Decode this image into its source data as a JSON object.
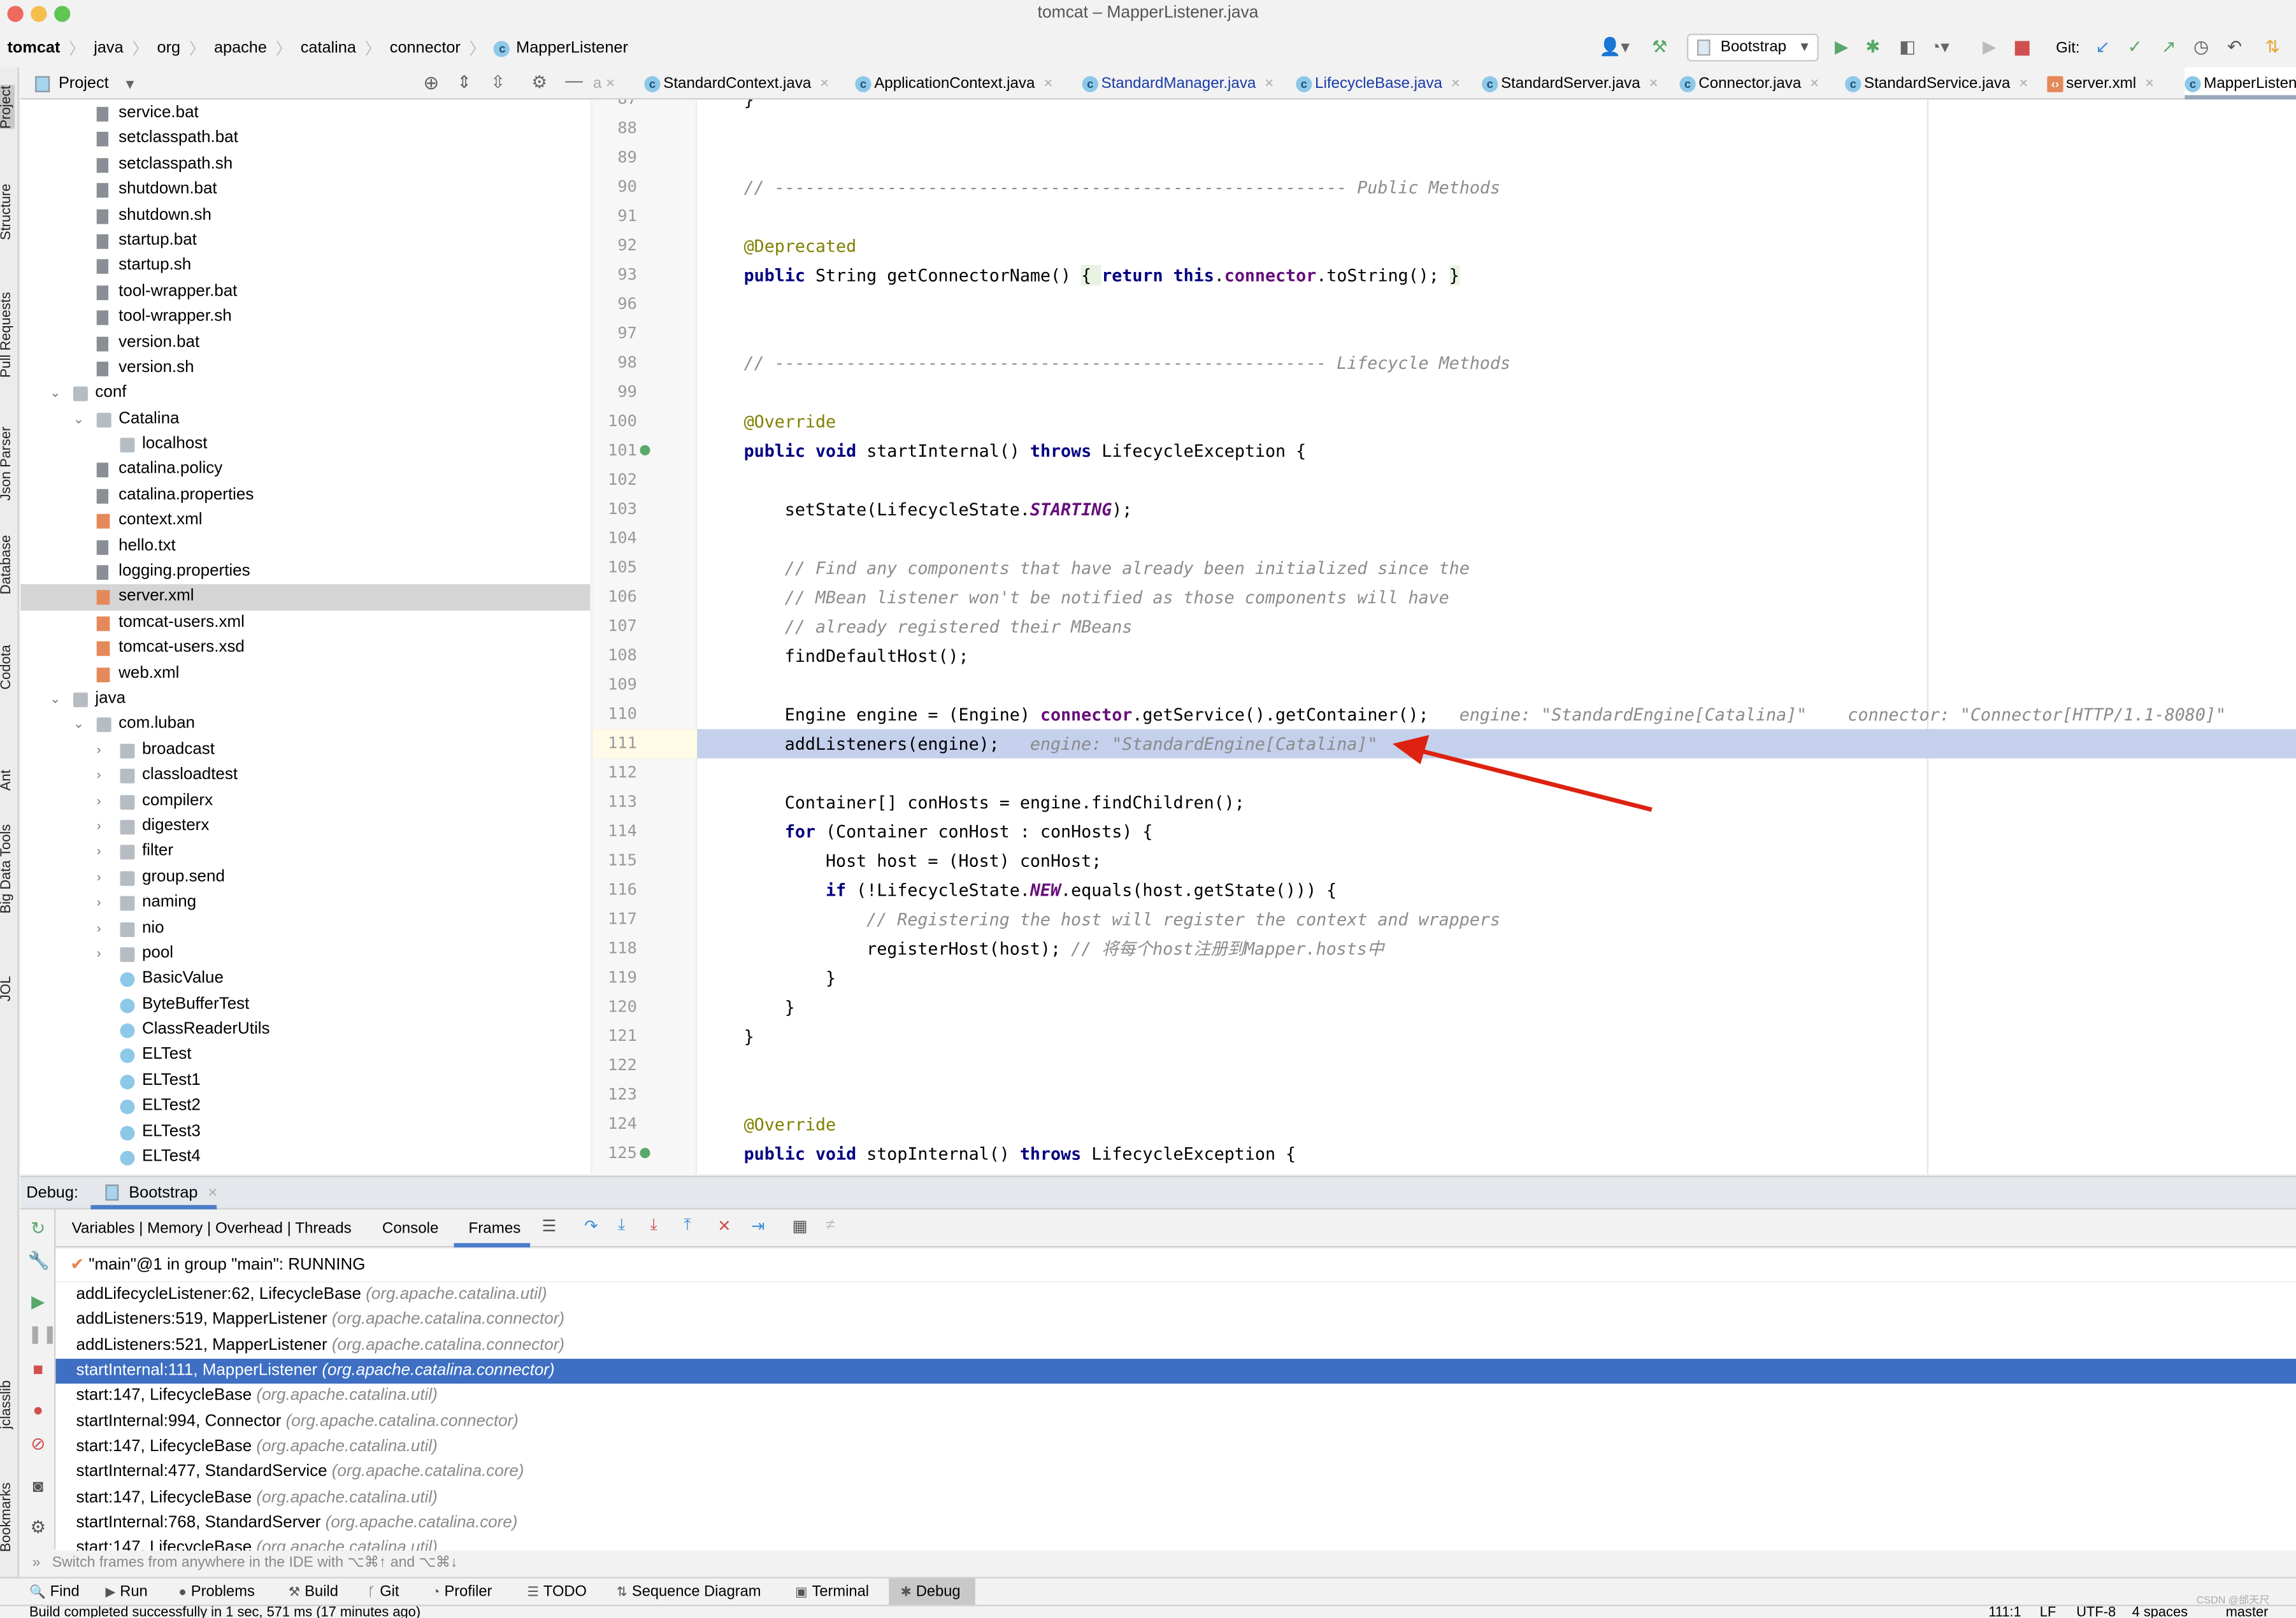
{
  "window": {
    "title": "tomcat – MapperListener.java"
  },
  "breadcrumb": [
    "tomcat",
    "java",
    "org",
    "apache",
    "catalina",
    "connector",
    "MapperListener"
  ],
  "toolbar": {
    "run_config": "Bootstrap",
    "git_label": "Git:",
    "stop_color": "#d05050",
    "run_color": "#59a869"
  },
  "project_panel": {
    "title": "Project"
  },
  "left_strip": [
    "Project",
    "Structure",
    "Pull Requests",
    "Json Parser",
    "Database",
    "Codota",
    "Ant",
    "Big Data Tools",
    "JOL",
    "jclasslib",
    "Bookmarks"
  ],
  "editor_tabs": [
    {
      "label": "StandardContext.java",
      "modified": false
    },
    {
      "label": "ApplicationContext.java",
      "modified": false
    },
    {
      "label": "StandardManager.java",
      "modified": true
    },
    {
      "label": "LifecycleBase.java",
      "modified": true
    },
    {
      "label": "StandardServer.java",
      "modified": false
    },
    {
      "label": "Connector.java",
      "modified": false
    },
    {
      "label": "StandardService.java",
      "modified": false
    },
    {
      "label": "server.xml",
      "modified": false
    },
    {
      "label": "MapperListener",
      "modified": false,
      "active": true
    }
  ],
  "tree": [
    {
      "label": "service.bat",
      "level": 1,
      "type": "file"
    },
    {
      "label": "setclasspath.bat",
      "level": 1,
      "type": "file"
    },
    {
      "label": "setclasspath.sh",
      "level": 1,
      "type": "file"
    },
    {
      "label": "shutdown.bat",
      "level": 1,
      "type": "file"
    },
    {
      "label": "shutdown.sh",
      "level": 1,
      "type": "file"
    },
    {
      "label": "startup.bat",
      "level": 1,
      "type": "file"
    },
    {
      "label": "startup.sh",
      "level": 1,
      "type": "file"
    },
    {
      "label": "tool-wrapper.bat",
      "level": 1,
      "type": "file"
    },
    {
      "label": "tool-wrapper.sh",
      "level": 1,
      "type": "file"
    },
    {
      "label": "version.bat",
      "level": 1,
      "type": "file"
    },
    {
      "label": "version.sh",
      "level": 1,
      "type": "file"
    },
    {
      "label": "conf",
      "level": 0,
      "type": "folder",
      "expanded": true
    },
    {
      "label": "Catalina",
      "level": 1,
      "type": "folder",
      "expanded": true
    },
    {
      "label": "localhost",
      "level": 2,
      "type": "folder"
    },
    {
      "label": "catalina.policy",
      "level": 1,
      "type": "file"
    },
    {
      "label": "catalina.properties",
      "level": 1,
      "type": "file"
    },
    {
      "label": "context.xml",
      "level": 1,
      "type": "xml"
    },
    {
      "label": "hello.txt",
      "level": 1,
      "type": "file"
    },
    {
      "label": "logging.properties",
      "level": 1,
      "type": "file"
    },
    {
      "label": "server.xml",
      "level": 1,
      "type": "xml",
      "selected": true
    },
    {
      "label": "tomcat-users.xml",
      "level": 1,
      "type": "xml"
    },
    {
      "label": "tomcat-users.xsd",
      "level": 1,
      "type": "xml"
    },
    {
      "label": "web.xml",
      "level": 1,
      "type": "xml"
    },
    {
      "label": "java",
      "level": 0,
      "type": "folder",
      "expanded": true
    },
    {
      "label": "com.luban",
      "level": 1,
      "type": "folder",
      "expanded": true
    },
    {
      "label": "broadcast",
      "level": 2,
      "type": "folder",
      "expanded": false
    },
    {
      "label": "classloadtest",
      "level": 2,
      "type": "folder",
      "expanded": false
    },
    {
      "label": "compilerx",
      "level": 2,
      "type": "folder",
      "expanded": false
    },
    {
      "label": "digesterx",
      "level": 2,
      "type": "folder",
      "expanded": false
    },
    {
      "label": "filter",
      "level": 2,
      "type": "folder",
      "expanded": false
    },
    {
      "label": "group.send",
      "level": 2,
      "type": "folder",
      "expanded": false
    },
    {
      "label": "naming",
      "level": 2,
      "type": "folder",
      "expanded": false
    },
    {
      "label": "nio",
      "level": 2,
      "type": "folder",
      "expanded": false
    },
    {
      "label": "pool",
      "level": 2,
      "type": "folder",
      "expanded": false
    },
    {
      "label": "BasicValue",
      "level": 2,
      "type": "class"
    },
    {
      "label": "ByteBufferTest",
      "level": 2,
      "type": "class"
    },
    {
      "label": "ClassReaderUtils",
      "level": 2,
      "type": "class"
    },
    {
      "label": "ELTest",
      "level": 2,
      "type": "class"
    },
    {
      "label": "ELTest1",
      "level": 2,
      "type": "class"
    },
    {
      "label": "ELTest2",
      "level": 2,
      "type": "class"
    },
    {
      "label": "ELTest3",
      "level": 2,
      "type": "class"
    },
    {
      "label": "ELTest4",
      "level": 2,
      "type": "class"
    }
  ],
  "code": {
    "current_line": "111",
    "lines": [
      {
        "n": "87",
        "t": [
          [
            "}",
            "plain"
          ]
        ]
      },
      {
        "n": "88",
        "t": []
      },
      {
        "n": "89",
        "t": []
      },
      {
        "n": "90",
        "t": [
          [
            "// -------------------------------------------------------- Public Methods",
            "comment"
          ]
        ]
      },
      {
        "n": "91",
        "t": []
      },
      {
        "n": "92",
        "t": [
          [
            "@Deprecated",
            "annotation"
          ]
        ]
      },
      {
        "n": "93",
        "t": [
          [
            "public",
            "keyword"
          ],
          [
            " String getConnectorName() ",
            "plain"
          ],
          [
            "{ ",
            "fold"
          ],
          [
            "return",
            "keyword"
          ],
          [
            " ",
            "plain"
          ],
          [
            "this",
            "keyword"
          ],
          [
            ".",
            "plain"
          ],
          [
            "connector",
            "field"
          ],
          [
            ".toString(); ",
            "plain"
          ],
          [
            "}",
            "fold"
          ]
        ]
      },
      {
        "n": "96",
        "t": []
      },
      {
        "n": "97",
        "t": []
      },
      {
        "n": "98",
        "t": [
          [
            "// ------------------------------------------------------ Lifecycle Methods",
            "comment"
          ]
        ]
      },
      {
        "n": "99",
        "t": []
      },
      {
        "n": "100",
        "t": [
          [
            "@Override",
            "annotation"
          ]
        ]
      },
      {
        "n": "101",
        "t": [
          [
            "public",
            "keyword"
          ],
          [
            " ",
            "plain"
          ],
          [
            "void",
            "keyword"
          ],
          [
            " startInternal() ",
            "plain"
          ],
          [
            "throws",
            "keyword"
          ],
          [
            " LifecycleException {",
            "plain"
          ]
        ],
        "marker": true
      },
      {
        "n": "102",
        "t": []
      },
      {
        "n": "103",
        "t": [
          [
            "    setState(LifecycleState.",
            "plain"
          ],
          [
            "STARTING",
            "static"
          ],
          [
            ");",
            "plain"
          ]
        ]
      },
      {
        "n": "104",
        "t": []
      },
      {
        "n": "105",
        "t": [
          [
            "    // Find any components that have already been initialized since the",
            "comment"
          ]
        ]
      },
      {
        "n": "106",
        "t": [
          [
            "    // MBean listener won't be notified as those components will have",
            "comment"
          ]
        ]
      },
      {
        "n": "107",
        "t": [
          [
            "    // already registered their MBeans",
            "comment"
          ]
        ]
      },
      {
        "n": "108",
        "t": [
          [
            "    findDefaultHost();",
            "plain"
          ]
        ]
      },
      {
        "n": "109",
        "t": []
      },
      {
        "n": "110",
        "t": [
          [
            "    Engine engine = (Engine) ",
            "plain"
          ],
          [
            "connector",
            "field"
          ],
          [
            ".getService().getContainer();",
            "plain"
          ],
          [
            "   engine: \"StandardEngine[Catalina]\"    connector: \"Connector[HTTP/1.1-8080]\"",
            "hint"
          ]
        ]
      },
      {
        "n": "111",
        "t": [
          [
            "    addListeners(engine);",
            "plain"
          ],
          [
            "   engine: \"StandardEngine[Catalina]\"",
            "hint"
          ]
        ]
      },
      {
        "n": "112",
        "t": []
      },
      {
        "n": "113",
        "t": [
          [
            "    Container[] conHosts = engine.findChildren();",
            "plain"
          ]
        ]
      },
      {
        "n": "114",
        "t": [
          [
            "    ",
            "plain"
          ],
          [
            "for",
            "keyword"
          ],
          [
            " (Container conHost : conHosts) {",
            "plain"
          ]
        ]
      },
      {
        "n": "115",
        "t": [
          [
            "        Host host = (Host) conHost;",
            "plain"
          ]
        ]
      },
      {
        "n": "116",
        "t": [
          [
            "        ",
            "plain"
          ],
          [
            "if",
            "keyword"
          ],
          [
            " (!LifecycleState.",
            "plain"
          ],
          [
            "NEW",
            "static"
          ],
          [
            ".equals(host.getState())) {",
            "plain"
          ]
        ]
      },
      {
        "n": "117",
        "t": [
          [
            "            // Registering the host will register the context and wrappers",
            "comment"
          ]
        ]
      },
      {
        "n": "118",
        "t": [
          [
            "            registerHost(host); ",
            "plain"
          ],
          [
            "// 将每个host注册到Mapper.hosts中",
            "comment"
          ]
        ]
      },
      {
        "n": "119",
        "t": [
          [
            "        }",
            "plain"
          ]
        ]
      },
      {
        "n": "120",
        "t": [
          [
            "    }",
            "plain"
          ]
        ]
      },
      {
        "n": "121",
        "t": [
          [
            "}",
            "plain"
          ]
        ]
      },
      {
        "n": "122",
        "t": []
      },
      {
        "n": "123",
        "t": []
      },
      {
        "n": "124",
        "t": [
          [
            "@Override",
            "annotation"
          ]
        ]
      },
      {
        "n": "125",
        "t": [
          [
            "public",
            "keyword"
          ],
          [
            " ",
            "plain"
          ],
          [
            "void",
            "keyword"
          ],
          [
            " stopInternal() ",
            "plain"
          ],
          [
            "throws",
            "keyword"
          ],
          [
            " LifecycleException {",
            "plain"
          ]
        ],
        "marker": true
      }
    ]
  },
  "debug": {
    "label": "Debug:",
    "session": "Bootstrap",
    "tabs": [
      "Variables | Memory | Overhead | Threads",
      "Console",
      "Frames"
    ],
    "active_tab": "Frames",
    "thread": "\"main\"@1 in group \"main\": RUNNING",
    "frames": [
      {
        "method": "addLifecycleListener:62, LifecycleBase",
        "pkg": "(org.apache.catalina.util)"
      },
      {
        "method": "addListeners:519, MapperListener",
        "pkg": "(org.apache.catalina.connector)"
      },
      {
        "method": "addListeners:521, MapperListener",
        "pkg": "(org.apache.catalina.connector)"
      },
      {
        "method": "startInternal:111, MapperListener",
        "pkg": "(org.apache.catalina.connector)",
        "selected": true
      },
      {
        "method": "start:147, LifecycleBase",
        "pkg": "(org.apache.catalina.util)"
      },
      {
        "method": "startInternal:994, Connector",
        "pkg": "(org.apache.catalina.connector)"
      },
      {
        "method": "start:147, LifecycleBase",
        "pkg": "(org.apache.catalina.util)"
      },
      {
        "method": "startInternal:477, StandardService",
        "pkg": "(org.apache.catalina.core)"
      },
      {
        "method": "start:147, LifecycleBase",
        "pkg": "(org.apache.catalina.util)"
      },
      {
        "method": "startInternal:768, StandardServer",
        "pkg": "(org.apache.catalina.core)"
      },
      {
        "method": "start:147, LifecycleBase",
        "pkg": "(org.apache.catalina.util)"
      }
    ],
    "hint": "Switch frames from anywhere in the IDE with ⌥⌘↑ and ⌥⌘↓"
  },
  "bottom_tools": [
    "Find",
    "Run",
    "Problems",
    "Build",
    "Git",
    "Profiler",
    "TODO",
    "Sequence Diagram",
    "Terminal",
    "Debug"
  ],
  "active_bottom_tool": "Debug",
  "status": {
    "message": "Build completed successfully in 1 sec, 571 ms (17 minutes ago)",
    "position": "111:1",
    "line_sep": "LF",
    "encoding": "UTF-8",
    "indent": "4 spaces",
    "branch": "master"
  },
  "watermark": "CSDN @邰天尺",
  "annotation_arrow_color": "#dd2211"
}
